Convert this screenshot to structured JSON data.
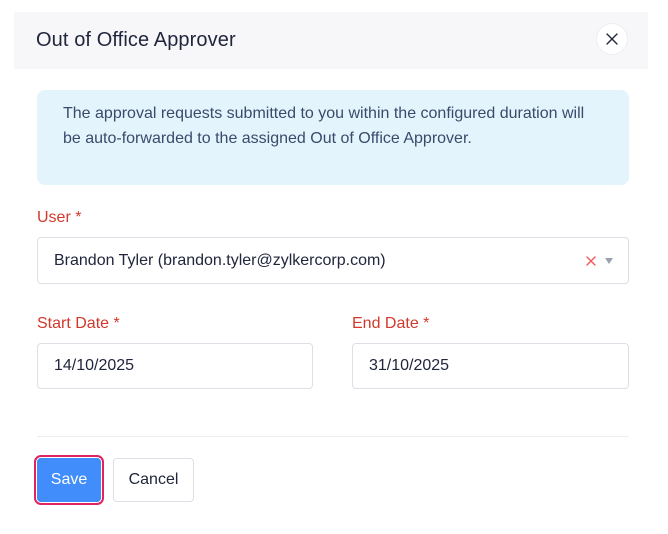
{
  "dialog": {
    "title": "Out of Office Approver",
    "close_icon": "close-icon"
  },
  "info": {
    "message": "The approval requests submitted to you within the configured duration will be auto-forwarded to the assigned Out of Office Approver."
  },
  "user_field": {
    "label": "User *",
    "value": "Brandon Tyler (brandon.tyler@zylkercorp.com)",
    "clear_icon": "clear-icon",
    "dropdown_icon": "caret-down-icon"
  },
  "start_date": {
    "label": "Start Date *",
    "value": "14/10/2025"
  },
  "end_date": {
    "label": "End Date *",
    "value": "31/10/2025"
  },
  "actions": {
    "save_label": "Save",
    "cancel_label": "Cancel"
  },
  "colors": {
    "primary": "#408dfb",
    "required_label": "#d0392b",
    "info_background": "#e3f4fc",
    "focus_outline": "#e0245e"
  }
}
